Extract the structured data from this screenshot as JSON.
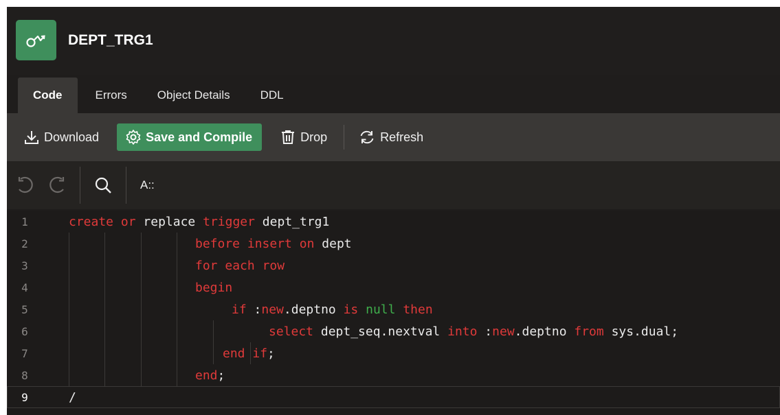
{
  "header": {
    "title": "DEPT_TRG1",
    "icon": "trigger-icon"
  },
  "tabs": [
    {
      "label": "Code"
    },
    {
      "label": "Errors"
    },
    {
      "label": "Object Details"
    },
    {
      "label": "DDL"
    }
  ],
  "toolbar": {
    "download_label": "Download",
    "save_compile_label": "Save and Compile",
    "drop_label": "Drop",
    "refresh_label": "Refresh"
  },
  "editor_toolbar": {
    "font_label": "A::"
  },
  "code": {
    "line_numbers": [
      "1",
      "2",
      "3",
      "4",
      "5",
      "6",
      "7",
      "8",
      "9"
    ],
    "current_line": 9,
    "lines": [
      [
        [
          "kw",
          "create"
        ],
        [
          "t",
          " "
        ],
        [
          "kw",
          "or"
        ],
        [
          "t",
          " replace "
        ],
        [
          "kw",
          "trigger"
        ],
        [
          "t",
          " dept_trg1"
        ]
      ],
      [
        [
          "kw",
          "before"
        ],
        [
          "t",
          " "
        ],
        [
          "kw",
          "insert"
        ],
        [
          "t",
          " "
        ],
        [
          "kw",
          "on"
        ],
        [
          "t",
          " dept"
        ]
      ],
      [
        [
          "kw",
          "for"
        ],
        [
          "t",
          " "
        ],
        [
          "kw",
          "each"
        ],
        [
          "t",
          " "
        ],
        [
          "kw",
          "row"
        ]
      ],
      [
        [
          "kw",
          "begin"
        ]
      ],
      [
        [
          "kw",
          "if"
        ],
        [
          "t",
          " :"
        ],
        [
          "kw",
          "new"
        ],
        [
          "t",
          ".deptno "
        ],
        [
          "kw",
          "is"
        ],
        [
          "t",
          " "
        ],
        [
          "grn",
          "null"
        ],
        [
          "t",
          " "
        ],
        [
          "kw",
          "then"
        ]
      ],
      [
        [
          "kw",
          "select"
        ],
        [
          "t",
          " dept_seq.nextval "
        ],
        [
          "kw",
          "into"
        ],
        [
          "t",
          " :"
        ],
        [
          "kw",
          "new"
        ],
        [
          "t",
          ".deptno "
        ],
        [
          "kw",
          "from"
        ],
        [
          "t",
          " sys.dual;"
        ]
      ],
      [
        [
          "kw",
          "end"
        ],
        [
          "t",
          " "
        ],
        [
          "kw",
          "if"
        ],
        [
          "t",
          ";"
        ]
      ],
      [
        [
          "kw",
          "end"
        ],
        [
          "t",
          ";"
        ]
      ],
      [
        [
          "t",
          "/"
        ]
      ]
    ]
  },
  "colors": {
    "accent_green": "#3f8f5c",
    "keyword_red": "#e03a3a",
    "literal_green": "#3fae4c"
  }
}
